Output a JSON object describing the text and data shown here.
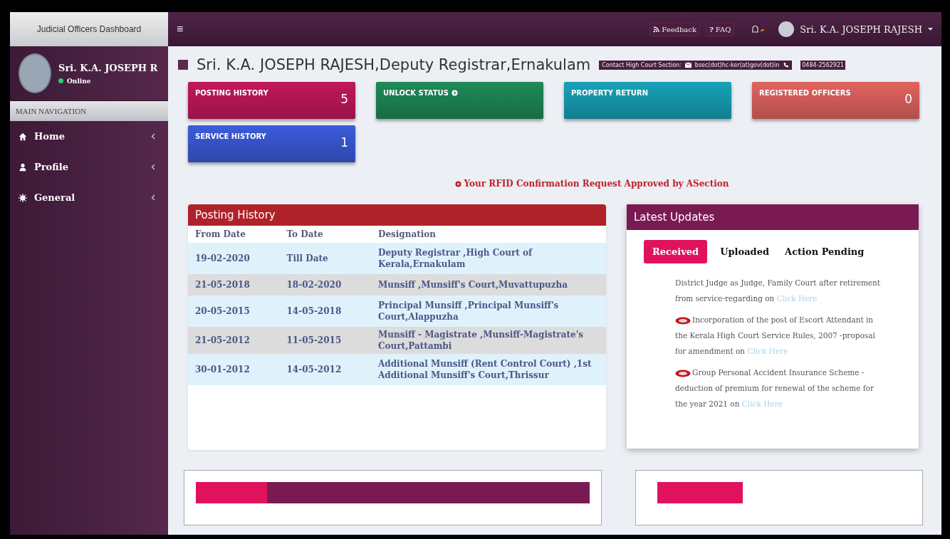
{
  "sidebar": {
    "brand": "Judicial Officers Dashboard",
    "user": {
      "name": "Sri. K.A. JOSEPH R",
      "status": "Online"
    },
    "nav_header": "MAIN NAVIGATION",
    "items": [
      {
        "label": "Home",
        "kind": "home"
      },
      {
        "label": "Profile",
        "kind": "person"
      },
      {
        "label": "General",
        "kind": "gear"
      }
    ]
  },
  "topbar": {
    "menu": "≡",
    "links": [
      {
        "label": "Feedback",
        "kind": "feed"
      },
      {
        "label": "FAQ",
        "kind": "faq",
        "icon": "?"
      }
    ],
    "user_name": "Sri. K.A. JOSEPH RAJESH"
  },
  "header": {
    "title": "Sri. K.A. JOSEPH RAJESH,Deputy Registrar,Ernakulam",
    "contact_label": "Contact High Court Section:",
    "email": "bsec(dot)hc-ker(at)gov(dot)in",
    "phone": "0484-2562921"
  },
  "tiles": [
    {
      "label": "POSTING HISTORY",
      "count": "5",
      "color": "#c2185b"
    },
    {
      "label": "UNLOCK STATUS",
      "color": "#1e8a58"
    },
    {
      "label": "PROPERTY RETURN",
      "color": "#17a2b8"
    },
    {
      "label": "REGISTERED OFFICERS",
      "count": "0",
      "color": "#e2645f"
    },
    {
      "label": "SERVICE HISTORY",
      "count": "1",
      "color": "#3b5bdb"
    }
  ],
  "alert": "Your RFID Confirmation Request Approved by ASection",
  "posting_history": {
    "title": "Posting History",
    "columns": [
      "From Date",
      "To Date",
      "Designation"
    ],
    "rows": [
      [
        "19-02-2020",
        "Till Date",
        "Deputy Registrar ,High Court of Kerala,Ernakulam"
      ],
      [
        "21-05-2018",
        "18-02-2020",
        "Munsiff ,Munsiff's Court,Muvattupuzha"
      ],
      [
        "20-05-2015",
        "14-05-2018",
        "Principal Munsiff ,Principal Munsiff's Court,Alappuzha"
      ],
      [
        "21-05-2012",
        "11-05-2015",
        "Munsiff - Magistrate ,Munsiff-Magistrate's Court,Pattambi"
      ],
      [
        "30-01-2012",
        "14-05-2012",
        "Additional Munsiff (Rent Control Court) ,1st Additional Munsiff's Court,Thrissur"
      ]
    ]
  },
  "latest_updates": {
    "title": "Latest Updates",
    "tabs": [
      {
        "label": "Received",
        "selected": true
      },
      {
        "label": "Uploaded",
        "selected": false
      },
      {
        "label": "Action Pending",
        "selected": false
      }
    ],
    "items": [
      {
        "text": "District Judge as Judge, Family Court after retirement from service-regarding on",
        "new": false,
        "link": "Click Here"
      },
      {
        "text": "Incorporation of the post of Escort Attendant in the Kerala High Court Service Rules, 2007 -proposal for amendment on",
        "new": true,
        "link": "Click Here"
      },
      {
        "text": "Group Personal Accident Insurance Scheme -deduction of premium for renewal of the scheme for the year 2021 on",
        "new": true,
        "link": "Click Here"
      }
    ]
  }
}
